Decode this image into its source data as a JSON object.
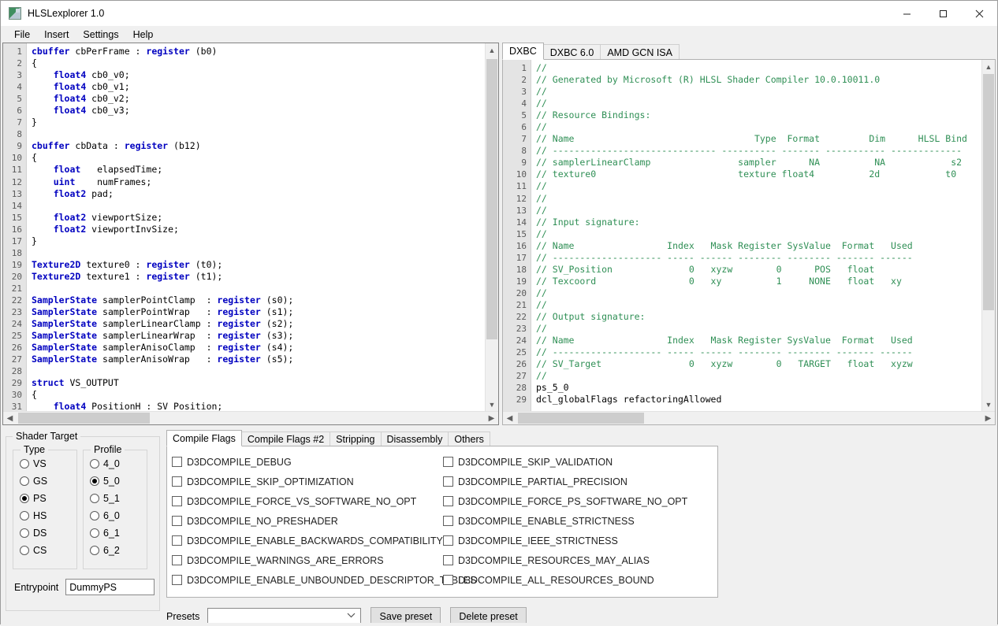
{
  "window": {
    "title": "HLSLexplorer 1.0",
    "icon": "app-icon",
    "minimize": "—",
    "maximize": "☐",
    "close": "✕"
  },
  "menubar": {
    "items": [
      {
        "label": "File"
      },
      {
        "label": "Insert"
      },
      {
        "label": "Settings"
      },
      {
        "label": "Help"
      }
    ]
  },
  "hlsl_editor": {
    "first_line": 1,
    "last_line": 31,
    "lines": [
      {
        "n": 1,
        "tokens": [
          {
            "t": "kw",
            "s": "cbuffer"
          },
          {
            "t": "plain",
            "s": " cbPerFrame : "
          },
          {
            "t": "kw",
            "s": "register"
          },
          {
            "t": "plain",
            "s": " (b0)"
          }
        ]
      },
      {
        "n": 2,
        "tokens": [
          {
            "t": "plain",
            "s": "{"
          }
        ]
      },
      {
        "n": 3,
        "tokens": [
          {
            "t": "plain",
            "s": "    "
          },
          {
            "t": "kw",
            "s": "float4"
          },
          {
            "t": "plain",
            "s": " cb0_v0;"
          }
        ]
      },
      {
        "n": 4,
        "tokens": [
          {
            "t": "plain",
            "s": "    "
          },
          {
            "t": "kw",
            "s": "float4"
          },
          {
            "t": "plain",
            "s": " cb0_v1;"
          }
        ]
      },
      {
        "n": 5,
        "tokens": [
          {
            "t": "plain",
            "s": "    "
          },
          {
            "t": "kw",
            "s": "float4"
          },
          {
            "t": "plain",
            "s": " cb0_v2;"
          }
        ]
      },
      {
        "n": 6,
        "tokens": [
          {
            "t": "plain",
            "s": "    "
          },
          {
            "t": "kw",
            "s": "float4"
          },
          {
            "t": "plain",
            "s": " cb0_v3;"
          }
        ]
      },
      {
        "n": 7,
        "tokens": [
          {
            "t": "plain",
            "s": "}"
          }
        ]
      },
      {
        "n": 8,
        "tokens": []
      },
      {
        "n": 9,
        "tokens": [
          {
            "t": "kw",
            "s": "cbuffer"
          },
          {
            "t": "plain",
            "s": " cbData : "
          },
          {
            "t": "kw",
            "s": "register"
          },
          {
            "t": "plain",
            "s": " (b12)"
          }
        ]
      },
      {
        "n": 10,
        "tokens": [
          {
            "t": "plain",
            "s": "{"
          }
        ]
      },
      {
        "n": 11,
        "tokens": [
          {
            "t": "plain",
            "s": "    "
          },
          {
            "t": "kw",
            "s": "float"
          },
          {
            "t": "plain",
            "s": "   elapsedTime;"
          }
        ]
      },
      {
        "n": 12,
        "tokens": [
          {
            "t": "plain",
            "s": "    "
          },
          {
            "t": "kw",
            "s": "uint"
          },
          {
            "t": "plain",
            "s": "    numFrames;"
          }
        ]
      },
      {
        "n": 13,
        "tokens": [
          {
            "t": "plain",
            "s": "    "
          },
          {
            "t": "kw",
            "s": "float2"
          },
          {
            "t": "plain",
            "s": " pad;"
          }
        ]
      },
      {
        "n": 14,
        "tokens": []
      },
      {
        "n": 15,
        "tokens": [
          {
            "t": "plain",
            "s": "    "
          },
          {
            "t": "kw",
            "s": "float2"
          },
          {
            "t": "plain",
            "s": " viewportSize;"
          }
        ]
      },
      {
        "n": 16,
        "tokens": [
          {
            "t": "plain",
            "s": "    "
          },
          {
            "t": "kw",
            "s": "float2"
          },
          {
            "t": "plain",
            "s": " viewportInvSize;"
          }
        ]
      },
      {
        "n": 17,
        "tokens": [
          {
            "t": "plain",
            "s": "}"
          }
        ]
      },
      {
        "n": 18,
        "tokens": []
      },
      {
        "n": 19,
        "tokens": [
          {
            "t": "kw",
            "s": "Texture2D"
          },
          {
            "t": "plain",
            "s": " texture0 : "
          },
          {
            "t": "kw",
            "s": "register"
          },
          {
            "t": "plain",
            "s": " (t0);"
          }
        ]
      },
      {
        "n": 20,
        "tokens": [
          {
            "t": "kw",
            "s": "Texture2D"
          },
          {
            "t": "plain",
            "s": " texture1 : "
          },
          {
            "t": "kw",
            "s": "register"
          },
          {
            "t": "plain",
            "s": " (t1);"
          }
        ]
      },
      {
        "n": 21,
        "tokens": []
      },
      {
        "n": 22,
        "tokens": [
          {
            "t": "kw",
            "s": "SamplerState"
          },
          {
            "t": "plain",
            "s": " samplerPointClamp  : "
          },
          {
            "t": "kw",
            "s": "register"
          },
          {
            "t": "plain",
            "s": " (s0);"
          }
        ]
      },
      {
        "n": 23,
        "tokens": [
          {
            "t": "kw",
            "s": "SamplerState"
          },
          {
            "t": "plain",
            "s": " samplerPointWrap   : "
          },
          {
            "t": "kw",
            "s": "register"
          },
          {
            "t": "plain",
            "s": " (s1);"
          }
        ]
      },
      {
        "n": 24,
        "tokens": [
          {
            "t": "kw",
            "s": "SamplerState"
          },
          {
            "t": "plain",
            "s": " samplerLinearClamp : "
          },
          {
            "t": "kw",
            "s": "register"
          },
          {
            "t": "plain",
            "s": " (s2);"
          }
        ]
      },
      {
        "n": 25,
        "tokens": [
          {
            "t": "kw",
            "s": "SamplerState"
          },
          {
            "t": "plain",
            "s": " samplerLinearWrap  : "
          },
          {
            "t": "kw",
            "s": "register"
          },
          {
            "t": "plain",
            "s": " (s3);"
          }
        ]
      },
      {
        "n": 26,
        "tokens": [
          {
            "t": "kw",
            "s": "SamplerState"
          },
          {
            "t": "plain",
            "s": " samplerAnisoClamp  : "
          },
          {
            "t": "kw",
            "s": "register"
          },
          {
            "t": "plain",
            "s": " (s4);"
          }
        ]
      },
      {
        "n": 27,
        "tokens": [
          {
            "t": "kw",
            "s": "SamplerState"
          },
          {
            "t": "plain",
            "s": " samplerAnisoWrap   : "
          },
          {
            "t": "kw",
            "s": "register"
          },
          {
            "t": "plain",
            "s": " (s5);"
          }
        ]
      },
      {
        "n": 28,
        "tokens": []
      },
      {
        "n": 29,
        "tokens": [
          {
            "t": "kw",
            "s": "struct"
          },
          {
            "t": "plain",
            "s": " VS_OUTPUT"
          }
        ]
      },
      {
        "n": 30,
        "tokens": [
          {
            "t": "plain",
            "s": "{"
          }
        ]
      },
      {
        "n": 31,
        "tokens": [
          {
            "t": "plain",
            "s": "    "
          },
          {
            "t": "kw",
            "s": "float4"
          },
          {
            "t": "plain",
            "s": " PositionH : SV_Position;"
          }
        ]
      }
    ]
  },
  "output_panel": {
    "tabs": [
      {
        "label": "DXBC",
        "active": true
      },
      {
        "label": "DXBC 6.0",
        "active": false
      },
      {
        "label": "AMD GCN ISA",
        "active": false
      }
    ],
    "lines": [
      {
        "n": 1,
        "cls": "cmt",
        "s": "//"
      },
      {
        "n": 2,
        "cls": "cmt",
        "s": "// Generated by Microsoft (R) HLSL Shader Compiler 10.0.10011.0"
      },
      {
        "n": 3,
        "cls": "cmt",
        "s": "//"
      },
      {
        "n": 4,
        "cls": "cmt",
        "s": "//"
      },
      {
        "n": 5,
        "cls": "cmt",
        "s": "// Resource Bindings:"
      },
      {
        "n": 6,
        "cls": "cmt",
        "s": "//"
      },
      {
        "n": 7,
        "cls": "cmt",
        "s": "// Name                                 Type  Format         Dim      HLSL Bind"
      },
      {
        "n": 8,
        "cls": "cmt",
        "s": "// ------------------------------ ---------- ------- ----------- -------------"
      },
      {
        "n": 9,
        "cls": "cmt",
        "s": "// samplerLinearClamp                sampler      NA          NA            s2"
      },
      {
        "n": 10,
        "cls": "cmt",
        "s": "// texture0                          texture float4          2d            t0"
      },
      {
        "n": 11,
        "cls": "cmt",
        "s": "//"
      },
      {
        "n": 12,
        "cls": "cmt",
        "s": "//"
      },
      {
        "n": 13,
        "cls": "cmt",
        "s": "//"
      },
      {
        "n": 14,
        "cls": "cmt",
        "s": "// Input signature:"
      },
      {
        "n": 15,
        "cls": "cmt",
        "s": "//"
      },
      {
        "n": 16,
        "cls": "cmt",
        "s": "// Name                 Index   Mask Register SysValue  Format   Used"
      },
      {
        "n": 17,
        "cls": "cmt",
        "s": "// -------------------- ----- ------ -------- -------- ------- ------"
      },
      {
        "n": 18,
        "cls": "cmt",
        "s": "// SV_Position              0   xyzw        0      POS   float       "
      },
      {
        "n": 19,
        "cls": "cmt",
        "s": "// Texcoord                 0   xy          1     NONE   float   xy  "
      },
      {
        "n": 20,
        "cls": "cmt",
        "s": "//"
      },
      {
        "n": 21,
        "cls": "cmt",
        "s": "//"
      },
      {
        "n": 22,
        "cls": "cmt",
        "s": "// Output signature:"
      },
      {
        "n": 23,
        "cls": "cmt",
        "s": "//"
      },
      {
        "n": 24,
        "cls": "cmt",
        "s": "// Name                 Index   Mask Register SysValue  Format   Used"
      },
      {
        "n": 25,
        "cls": "cmt",
        "s": "// -------------------- ----- ------ -------- -------- ------- ------"
      },
      {
        "n": 26,
        "cls": "cmt",
        "s": "// SV_Target                0   xyzw        0   TARGET   float   xyzw"
      },
      {
        "n": 27,
        "cls": "cmt",
        "s": "//"
      },
      {
        "n": 28,
        "cls": "plain",
        "s": "ps_5_0"
      },
      {
        "n": 29,
        "cls": "plain",
        "s": "dcl_globalFlags refactoringAllowed"
      }
    ]
  },
  "shader_target": {
    "legend": "Shader Target",
    "type_group": {
      "legend": "Type",
      "options": [
        {
          "label": "VS",
          "checked": false
        },
        {
          "label": "GS",
          "checked": false
        },
        {
          "label": "PS",
          "checked": true
        },
        {
          "label": "HS",
          "checked": false
        },
        {
          "label": "DS",
          "checked": false
        },
        {
          "label": "CS",
          "checked": false
        }
      ]
    },
    "profile_group": {
      "legend": "Profile",
      "options": [
        {
          "label": "4_0",
          "checked": false
        },
        {
          "label": "5_0",
          "checked": true
        },
        {
          "label": "5_1",
          "checked": false
        },
        {
          "label": "6_0",
          "checked": false
        },
        {
          "label": "6_1",
          "checked": false
        },
        {
          "label": "6_2",
          "checked": false
        }
      ]
    },
    "entrypoint_label": "Entrypoint",
    "entrypoint_value": "DummyPS"
  },
  "flags_panel": {
    "tabs": [
      {
        "label": "Compile Flags",
        "active": true
      },
      {
        "label": "Compile Flags #2",
        "active": false
      },
      {
        "label": "Stripping",
        "active": false
      },
      {
        "label": "Disassembly",
        "active": false
      },
      {
        "label": "Others",
        "active": false
      }
    ],
    "left_column": [
      {
        "label": "D3DCOMPILE_DEBUG",
        "checked": false
      },
      {
        "label": "D3DCOMPILE_SKIP_OPTIMIZATION",
        "checked": false
      },
      {
        "label": "D3DCOMPILE_FORCE_VS_SOFTWARE_NO_OPT",
        "checked": false
      },
      {
        "label": "D3DCOMPILE_NO_PRESHADER",
        "checked": false
      },
      {
        "label": "D3DCOMPILE_ENABLE_BACKWARDS_COMPATIBILITY",
        "checked": false
      },
      {
        "label": "D3DCOMPILE_WARNINGS_ARE_ERRORS",
        "checked": false
      },
      {
        "label": "D3DCOMPILE_ENABLE_UNBOUNDED_DESCRIPTOR_TABLES",
        "checked": false
      }
    ],
    "right_column": [
      {
        "label": "D3DCOMPILE_SKIP_VALIDATION",
        "checked": false
      },
      {
        "label": "D3DCOMPILE_PARTIAL_PRECISION",
        "checked": false
      },
      {
        "label": "D3DCOMPILE_FORCE_PS_SOFTWARE_NO_OPT",
        "checked": false
      },
      {
        "label": "D3DCOMPILE_ENABLE_STRICTNESS",
        "checked": false
      },
      {
        "label": "D3DCOMPILE_IEEE_STRICTNESS",
        "checked": false
      },
      {
        "label": "D3DCOMPILE_RESOURCES_MAY_ALIAS",
        "checked": false
      },
      {
        "label": "D3DCOMPILE_ALL_RESOURCES_BOUND",
        "checked": false
      }
    ]
  },
  "presets": {
    "label": "Presets",
    "value": "",
    "placeholder": "",
    "chevron": "⌄",
    "save_label": "Save preset",
    "delete_label": "Delete preset"
  },
  "colors": {
    "keyword": "#0000c0",
    "comment": "#2f8f55",
    "gutter_bg": "#e4e4e4",
    "window_bg": "#f0f0f0",
    "scroll_thumb": "#cdcdcd"
  }
}
